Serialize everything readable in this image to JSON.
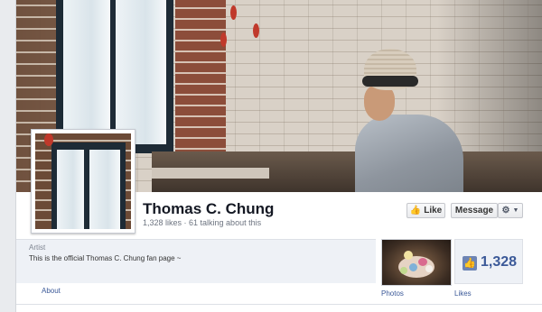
{
  "page": {
    "name": "Thomas C. Chung",
    "stats": "1,328 likes · 61 talking about this",
    "category": "Artist",
    "description": "This is the official Thomas C. Chung fan page ~"
  },
  "actions": {
    "like_label": "Like",
    "message_label": "Message",
    "settings_icon": "gear-icon",
    "dropdown_icon": "caret-down-icon"
  },
  "nav": {
    "about_label": "About",
    "photos_label": "Photos",
    "likes_label": "Likes",
    "likes_count": "1,328"
  },
  "colors": {
    "brand_blue": "#3b5998",
    "like_icon_blue": "#6d84b4"
  }
}
